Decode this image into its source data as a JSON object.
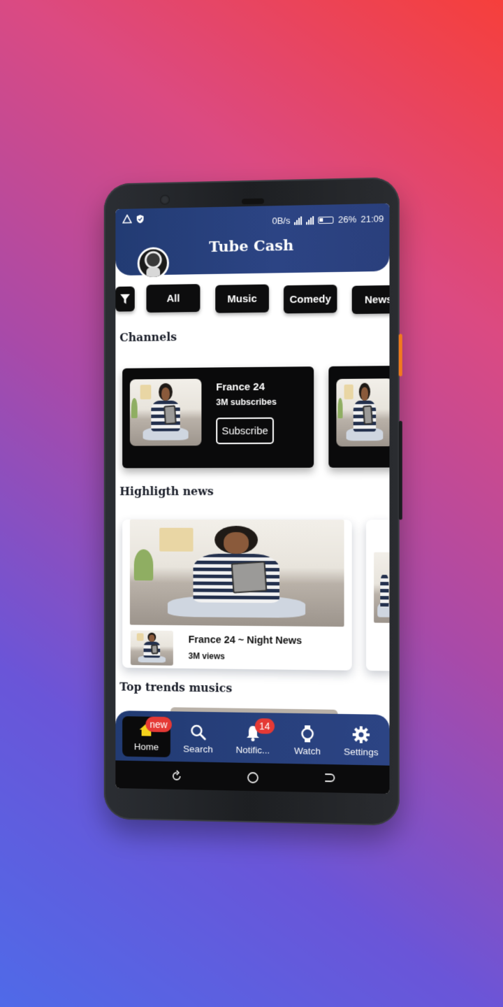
{
  "status_bar": {
    "data_rate": "0B/s",
    "battery": "26%",
    "time": "21:09"
  },
  "header": {
    "title": "Tube Cash"
  },
  "filters": {
    "chips": [
      "All",
      "Music",
      "Comedy",
      "News"
    ]
  },
  "sections": {
    "channels": "Channels",
    "highlights": "Highligth news",
    "top_music": "Top trends musics"
  },
  "channels": [
    {
      "name": "France 24",
      "subscribers": "3M subscribes",
      "button": "Subscribe"
    }
  ],
  "news": [
    {
      "title": "France 24  ~ Night News",
      "views": "3M views"
    }
  ],
  "bottom_nav": {
    "items": [
      {
        "label": "Home",
        "badge": "new",
        "icon": "home-icon"
      },
      {
        "label": "Search",
        "icon": "search-icon"
      },
      {
        "label": "Notific...",
        "badge": "14",
        "icon": "bell-icon"
      },
      {
        "label": "Watch",
        "icon": "watch-icon"
      },
      {
        "label": "Settings",
        "icon": "gear-icon"
      }
    ]
  },
  "colors": {
    "header": "#2c4484",
    "chip": "#0d0d0e",
    "badge": "#e53935"
  }
}
